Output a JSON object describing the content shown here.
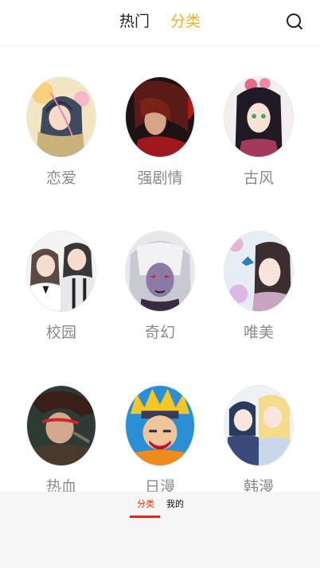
{
  "header": {
    "tabs": [
      {
        "label": "热门",
        "active": false
      },
      {
        "label": "分类",
        "active": true
      }
    ],
    "search_icon": "search-icon",
    "active_color": "#f0b227"
  },
  "categories": [
    {
      "label": "恋爱",
      "icon": "romance-avatar"
    },
    {
      "label": "强剧情",
      "icon": "drama-avatar"
    },
    {
      "label": "古风",
      "icon": "ancient-style-avatar"
    },
    {
      "label": "校园",
      "icon": "campus-avatar"
    },
    {
      "label": "奇幻",
      "icon": "fantasy-avatar"
    },
    {
      "label": "唯美",
      "icon": "aesthetic-avatar"
    },
    {
      "label": "热血",
      "icon": "hot-blooded-avatar"
    },
    {
      "label": "日漫",
      "icon": "japanese-manga-avatar"
    },
    {
      "label": "韩漫",
      "icon": "korean-manhwa-avatar"
    }
  ],
  "bottom_nav": {
    "tabs": [
      {
        "label": "分类",
        "active": true
      },
      {
        "label": "我的",
        "active": false
      }
    ],
    "accent_color": "#d43b1e"
  }
}
